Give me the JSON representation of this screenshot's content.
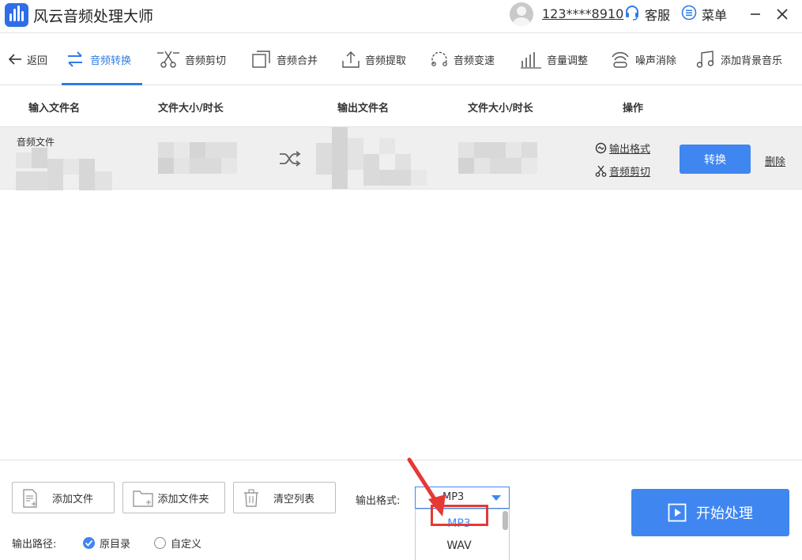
{
  "app": {
    "title": "风云音频处理大师",
    "username": "123****8910",
    "service_label": "客服",
    "menu_label": "菜单"
  },
  "toolbar": {
    "back_label": "返回",
    "items": [
      {
        "label": "音频转换",
        "icon": "convert-arrows-icon",
        "active": true
      },
      {
        "label": "音频剪切",
        "icon": "scissors-icon",
        "active": false
      },
      {
        "label": "音频合并",
        "icon": "merge-icon",
        "active": false
      },
      {
        "label": "音频提取",
        "icon": "upload-icon",
        "active": false
      },
      {
        "label": "音频变速",
        "icon": "speed-icon",
        "active": false
      },
      {
        "label": "音量调整",
        "icon": "volume-bars-icon",
        "active": false
      },
      {
        "label": "噪声消除",
        "icon": "wave-icon",
        "active": false
      },
      {
        "label": "添加背景音乐",
        "icon": "music-note-icon",
        "active": false
      }
    ]
  },
  "table": {
    "headers": [
      "输入文件名",
      "文件大小/时长",
      "输出文件名",
      "文件大小/时长",
      "操作"
    ],
    "rows": [
      {
        "input_name": "音频文件",
        "op_format": "输出格式",
        "op_cut": "音频剪切",
        "convert_label": "转换",
        "delete_label": "删除"
      }
    ]
  },
  "bottom": {
    "add_file": "添加文件",
    "add_folder": "添加文件夹",
    "clear_list": "清空列表",
    "format_label": "输出格式:",
    "format_value": "MP3",
    "format_options": [
      "MP3",
      "WAV"
    ],
    "path_label": "输出路径:",
    "path_options": [
      {
        "label": "原目录",
        "checked": true
      },
      {
        "label": "自定义",
        "checked": false
      }
    ],
    "start_label": "开始处理"
  },
  "colors": {
    "accent": "#3f86f0",
    "highlight": "#e53935",
    "row_bg": "#efefef"
  }
}
